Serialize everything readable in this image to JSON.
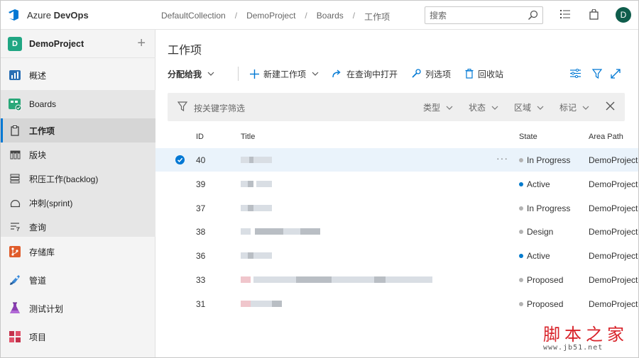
{
  "header": {
    "brand_prefix": "Azure ",
    "brand_bold": "DevOps",
    "breadcrumb": [
      "DefaultCollection",
      "DemoProject",
      "Boards",
      "工作项"
    ],
    "search_placeholder": "搜索",
    "avatar_initial": "D"
  },
  "sidebar": {
    "project_initial": "D",
    "project_name": "DemoProject",
    "add_label": "+",
    "items": [
      {
        "label": "概述",
        "icon": "overview-icon"
      },
      {
        "label": "Boards",
        "icon": "boards-icon"
      },
      {
        "label": "存储库",
        "icon": "repos-icon"
      },
      {
        "label": "管道",
        "icon": "pipelines-icon"
      },
      {
        "label": "测试计划",
        "icon": "test-plans-icon"
      },
      {
        "label": "项目",
        "icon": "artifacts-icon"
      }
    ],
    "boards_sub": [
      {
        "label": "工作项",
        "icon": "work-items-icon",
        "selected": true
      },
      {
        "label": "版块",
        "icon": "board-icon"
      },
      {
        "label": "积压工作(backlog)",
        "icon": "backlog-icon"
      },
      {
        "label": "冲刺(sprint)",
        "icon": "sprint-icon"
      },
      {
        "label": "查询",
        "icon": "query-icon"
      }
    ]
  },
  "main": {
    "title": "工作项",
    "toolbar": {
      "assigned": "分配给我",
      "new_item": "新建工作项",
      "open_query": "在查询中打开",
      "column_options": "列选项",
      "recycle_bin": "回收站"
    },
    "filter": {
      "placeholder": "按关键字筛选",
      "type": "类型",
      "state": "状态",
      "area": "区域",
      "tags": "标记"
    },
    "columns": {
      "id": "ID",
      "title": "Title",
      "state": "State",
      "area": "Area Path"
    },
    "rows": [
      {
        "id": "40",
        "state": "In Progress",
        "state_color": "#b2b2b2",
        "area": "DemoProject"
      },
      {
        "id": "39",
        "state": "Active",
        "state_color": "#007acc",
        "area": "DemoProject"
      },
      {
        "id": "37",
        "state": "In Progress",
        "state_color": "#b2b2b2",
        "area": "DemoProject"
      },
      {
        "id": "38",
        "state": "Design",
        "state_color": "#b2b2b2",
        "area": "DemoProject"
      },
      {
        "id": "36",
        "state": "Active",
        "state_color": "#007acc",
        "area": "DemoProject"
      },
      {
        "id": "33",
        "state": "Proposed",
        "state_color": "#b2b2b2",
        "area": "DemoProject"
      },
      {
        "id": "31",
        "state": "Proposed",
        "state_color": "#b2b2b2",
        "area": "DemoProject"
      }
    ],
    "more_label": "···"
  },
  "watermark": {
    "big": "脚本之家",
    "small": "www.jb51.net"
  }
}
